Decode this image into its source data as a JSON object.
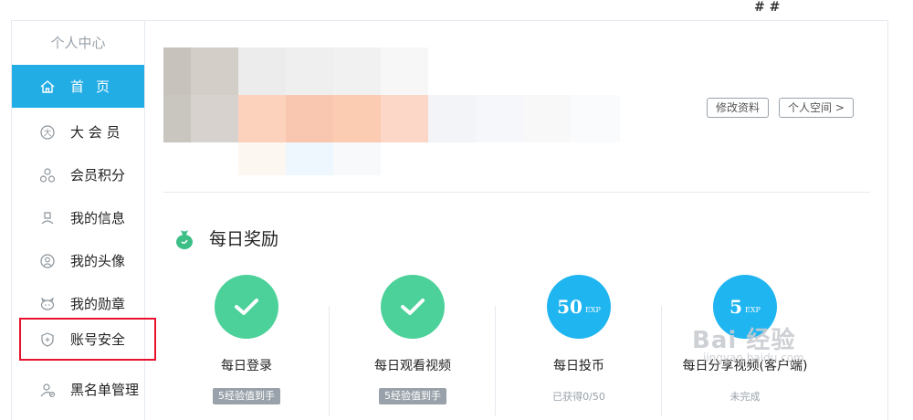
{
  "corner_mark": "# #",
  "sidebar": {
    "title": "个人中心",
    "items": [
      {
        "label": "首页",
        "icon": "home-icon",
        "active": true
      },
      {
        "label": "大 会 员",
        "icon": "vip-icon"
      },
      {
        "label": "会员积分",
        "icon": "points-icon"
      },
      {
        "label": "我的信息",
        "icon": "user-icon"
      },
      {
        "label": "我的头像",
        "icon": "avatar-icon"
      },
      {
        "label": "我的勋章",
        "icon": "medal-icon"
      },
      {
        "label": "账号安全",
        "icon": "shield-icon",
        "highlighted": true
      },
      {
        "label": "黑名单管理",
        "icon": "blacklist-icon"
      }
    ]
  },
  "profile": {
    "edit_button": "修改资料",
    "space_button": "个人空间 >"
  },
  "daily_reward": {
    "title": "每日奖励",
    "icon": "money-bag-icon",
    "tasks": [
      {
        "name": "每日登录",
        "state": "done",
        "badge": "5经验值到手"
      },
      {
        "name": "每日观看视频",
        "state": "done",
        "badge": "5经验值到手"
      },
      {
        "name": "每日投币",
        "state": "exp",
        "exp_value": "50",
        "exp_unit": "EXP",
        "status": "已获得0/50"
      },
      {
        "name": "每日分享视频(客户端)",
        "state": "exp",
        "exp_value": "5",
        "exp_unit": "EXP",
        "status": "未完成"
      }
    ]
  },
  "watermark": {
    "big": "Bai 经验",
    "small": "jingyan.baidu.com"
  },
  "colors": {
    "accent": "#23ade5",
    "highlight_border": "#e8112d",
    "green": "#4cd19a",
    "blue": "#1fb5f0"
  }
}
